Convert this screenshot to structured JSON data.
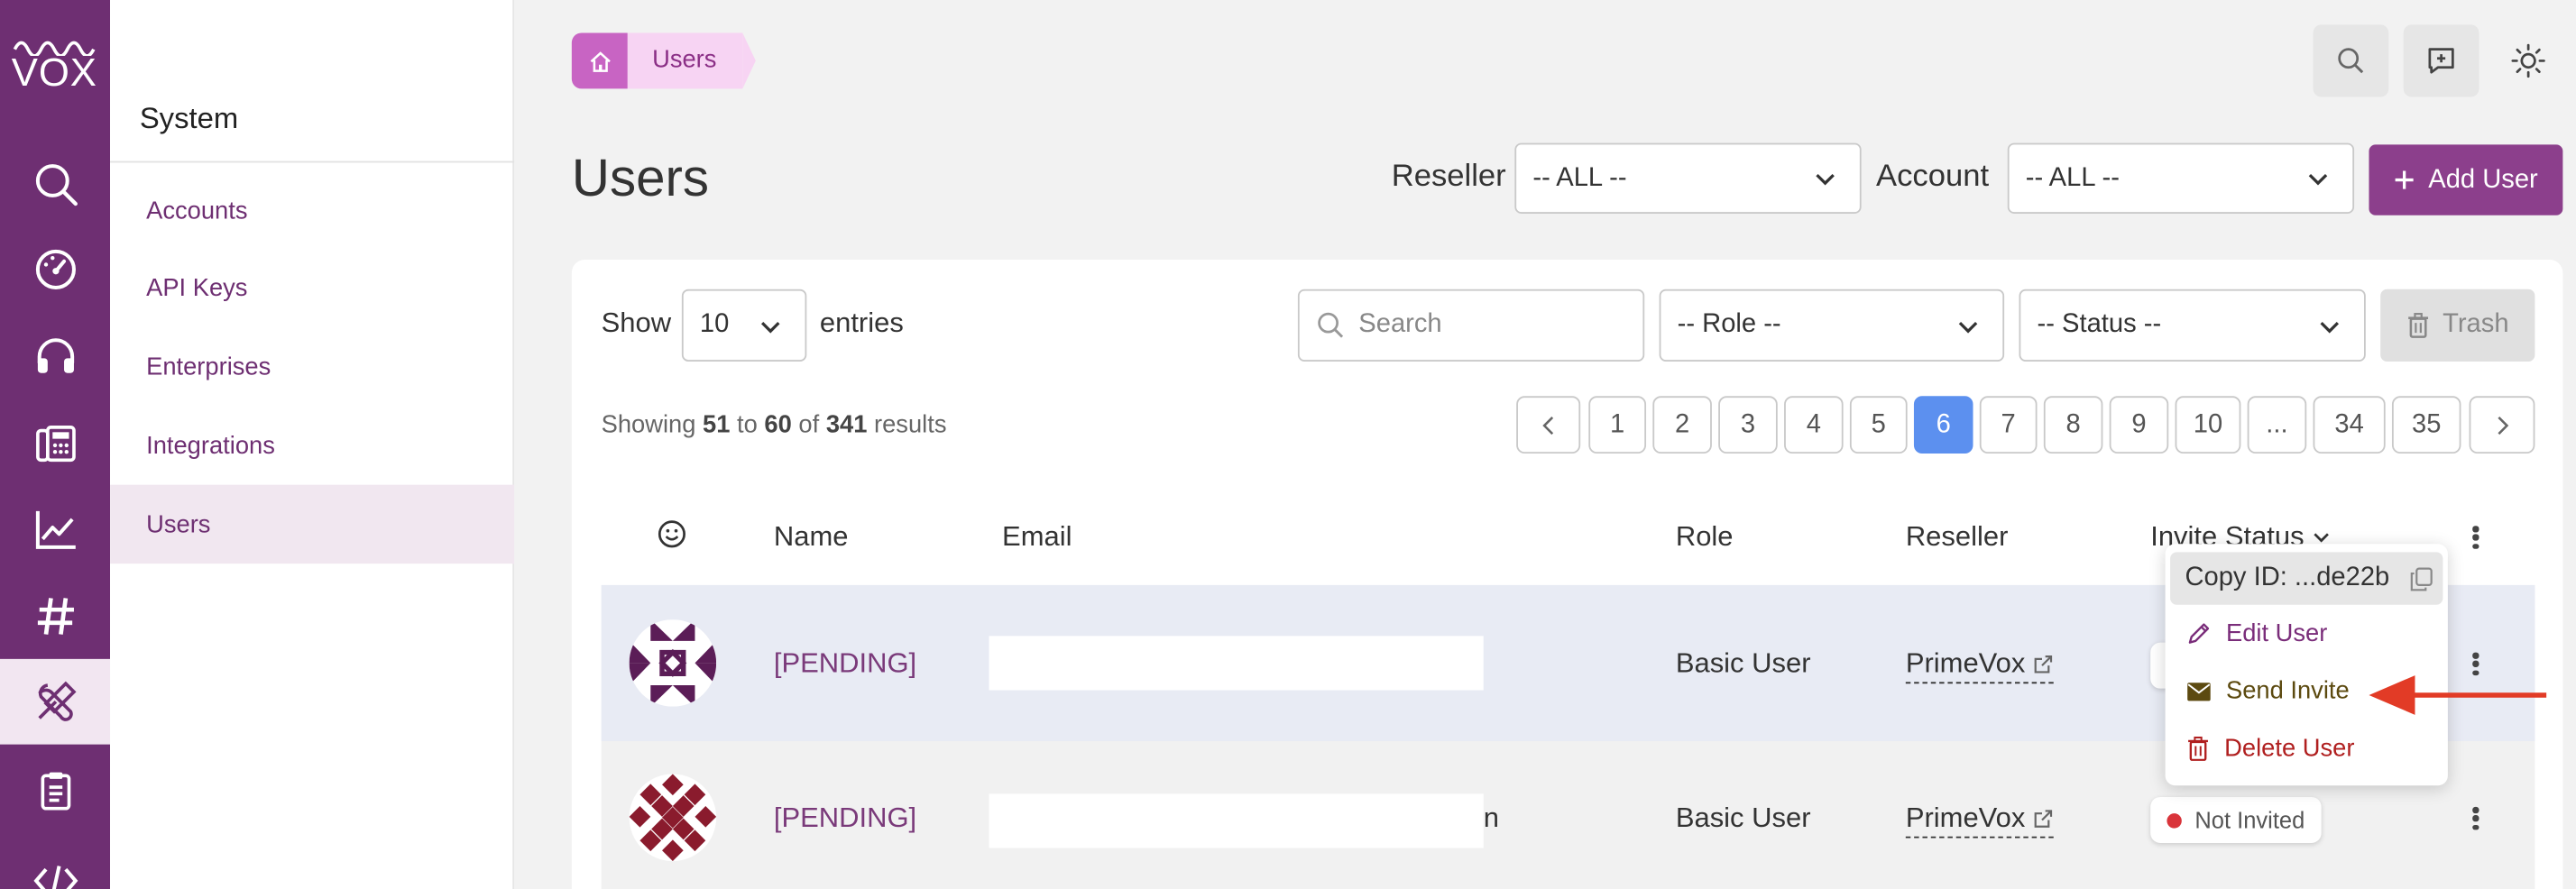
{
  "app": {
    "logo_text": "VOX"
  },
  "rail": {
    "icons": [
      "search-icon",
      "dashboard-gauge-icon",
      "headset-icon",
      "phone-system-icon",
      "analytics-chart-icon",
      "hashtag-icon",
      "tools-icon",
      "clipboard-icon",
      "code-icon"
    ],
    "active": "tools-icon"
  },
  "subnav": {
    "title": "System",
    "items": [
      {
        "label": "Accounts"
      },
      {
        "label": "API Keys"
      },
      {
        "label": "Enterprises"
      },
      {
        "label": "Integrations"
      },
      {
        "label": "Users",
        "active": true
      }
    ]
  },
  "breadcrumb": {
    "current": "Users"
  },
  "header": {
    "title": "Users",
    "reseller_label": "Reseller",
    "reseller_value": "-- ALL --",
    "account_label": "Account",
    "account_value": "-- ALL --",
    "add_user_label": "Add User"
  },
  "toolbar": {
    "show_label": "Show",
    "entries_value": "10",
    "entries_label": "entries",
    "search_placeholder": "Search",
    "role_value": "-- Role --",
    "status_value": "-- Status --",
    "trash_label": "Trash"
  },
  "results": {
    "prefix": "Showing",
    "from": "51",
    "to_word": "to",
    "to": "60",
    "of_word": "of",
    "total": "341",
    "suffix": "results"
  },
  "pagination": {
    "pages": [
      "1",
      "2",
      "3",
      "4",
      "5",
      "6",
      "7",
      "8",
      "9",
      "10",
      "...",
      "34",
      "35"
    ],
    "current": "6"
  },
  "table": {
    "headers": {
      "name": "Name",
      "email": "Email",
      "role": "Role",
      "reseller": "Reseller",
      "invite_status": "Invite Status"
    },
    "rows": [
      {
        "name": "[PENDING]",
        "email_tail": "",
        "role": "Basic User",
        "reseller": "PrimeVox",
        "invite_status": ""
      },
      {
        "name": "[PENDING]",
        "email_tail": "n",
        "role": "Basic User",
        "reseller": "PrimeVox",
        "invite_status": "Not Invited"
      }
    ]
  },
  "menu": {
    "copy_id": "Copy ID: ...de22b",
    "edit": "Edit User",
    "send": "Send Invite",
    "delete": "Delete User"
  },
  "colors": {
    "rail": "#6e2f72",
    "accent": "#8c3f8c",
    "active_page": "#5c90ef",
    "arrow": "#e23b26",
    "status_dot": "#d9343a"
  }
}
